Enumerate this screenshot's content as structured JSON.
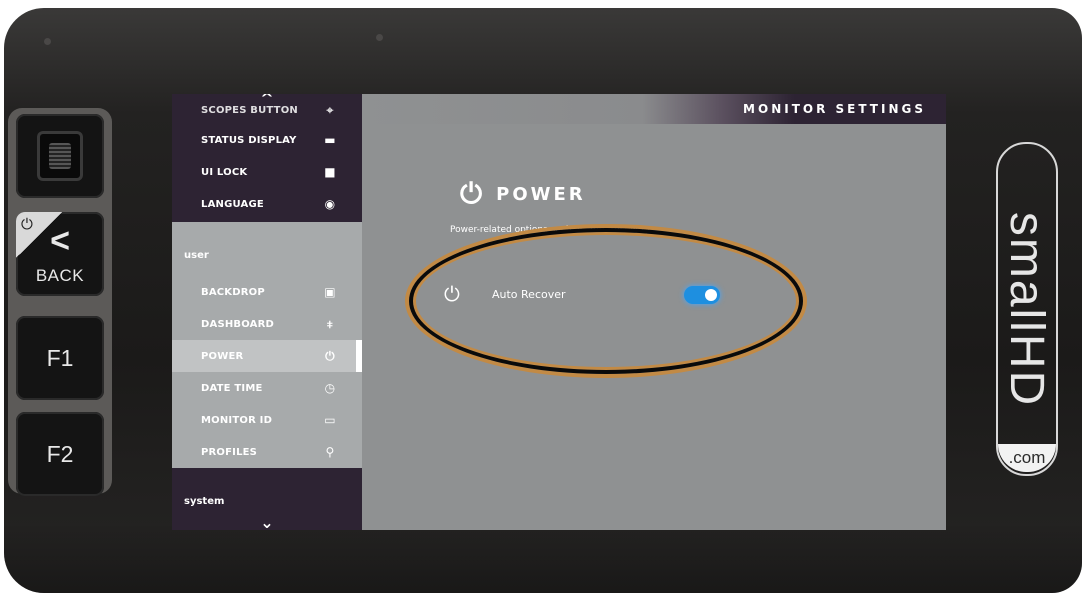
{
  "device": {
    "brand_name": "smallHD",
    "brand_suffix": ".com"
  },
  "hardware_buttons": {
    "back_label": "BACK",
    "f1_label": "F1",
    "f2_label": "F2"
  },
  "sidebar": {
    "top_items": [
      {
        "label": "SCOPES BUTTON",
        "icon": "scopes-icon"
      },
      {
        "label": "STATUS DISPLAY",
        "icon": "status-display-icon"
      },
      {
        "label": "UI LOCK",
        "icon": "lock-icon"
      },
      {
        "label": "LANGUAGE",
        "icon": "globe-icon"
      }
    ],
    "user_section_label": "user",
    "user_items": [
      {
        "label": "BACKDROP",
        "icon": "backdrop-icon"
      },
      {
        "label": "DASHBOARD",
        "icon": "dashboard-icon"
      },
      {
        "label": "POWER",
        "icon": "power-icon",
        "active": true
      },
      {
        "label": "DATE TIME",
        "icon": "clock-icon"
      },
      {
        "label": "MONITOR ID",
        "icon": "monitor-id-icon"
      },
      {
        "label": "PROFILES",
        "icon": "profiles-icon"
      }
    ],
    "system_section_label": "system"
  },
  "header": {
    "title": "MONITOR SETTINGS"
  },
  "page": {
    "heading": "POWER",
    "description": "Power-related options such as auto recovery.",
    "settings": [
      {
        "label": "Auto Recover",
        "icon": "power-icon",
        "enabled": true
      }
    ]
  },
  "colors": {
    "sidebar_dark": "#2d2333",
    "toggle_on": "#1e8fe0",
    "annotation_outline": "#0a0a0a",
    "annotation_glow": "#c28a45"
  }
}
